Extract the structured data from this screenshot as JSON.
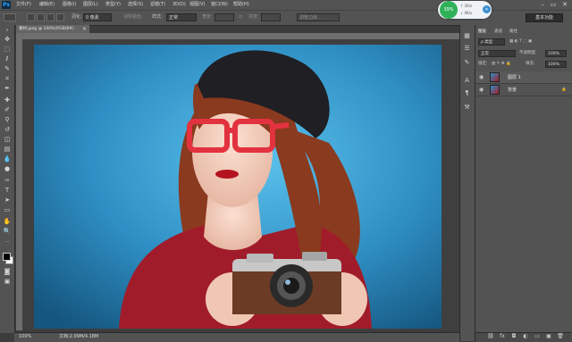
{
  "app": {
    "logo": "Ps"
  },
  "menu": {
    "items": [
      "文件(F)",
      "编辑(E)",
      "图像(I)",
      "图层(L)",
      "类型(Y)",
      "选择(S)",
      "滤镜(T)",
      "3D(D)",
      "视图(V)",
      "窗口(W)",
      "帮助(H)"
    ]
  },
  "window_controls": {
    "minimize": "–",
    "restore": "▭",
    "close": "✕"
  },
  "options_bar": {
    "feather_label": "羽化:",
    "feather_value": "0 像素",
    "antialias_label": "消除锯齿",
    "style_label": "样式:",
    "style_value": "正常",
    "width_label": "宽度:",
    "height_label": "高度:",
    "refine_edge_label": "调整边缘...",
    "workspace_label": "基本功能"
  },
  "speed_widget": {
    "percent": "39%",
    "row1_value": "2K/s",
    "row2_value": "0K/s",
    "button_glyph": "»"
  },
  "document": {
    "tab_title": "素材.jpeg @ 100%(RGB/8#)",
    "tab_close": "×",
    "zoom": "100%",
    "doc_size": "文档:2.09M/4.18M",
    "photo_colors": {
      "background_blue": "#2f8fc4",
      "glasses": "#e3323f",
      "sweater": "#a11c2a",
      "beret": "#1f1f24",
      "hair": "#8a3a1f"
    }
  },
  "layers_panel": {
    "tabs": [
      "图层",
      "通道",
      "路径"
    ],
    "filter_label": "ρ 类型",
    "blend_mode": "正常",
    "opacity_label": "不透明度:",
    "opacity_value": "100%",
    "lock_label": "锁定:",
    "fill_label": "填充:",
    "fill_value": "100%",
    "layers": [
      {
        "name": "图层 1"
      },
      {
        "name": "背景"
      }
    ]
  }
}
